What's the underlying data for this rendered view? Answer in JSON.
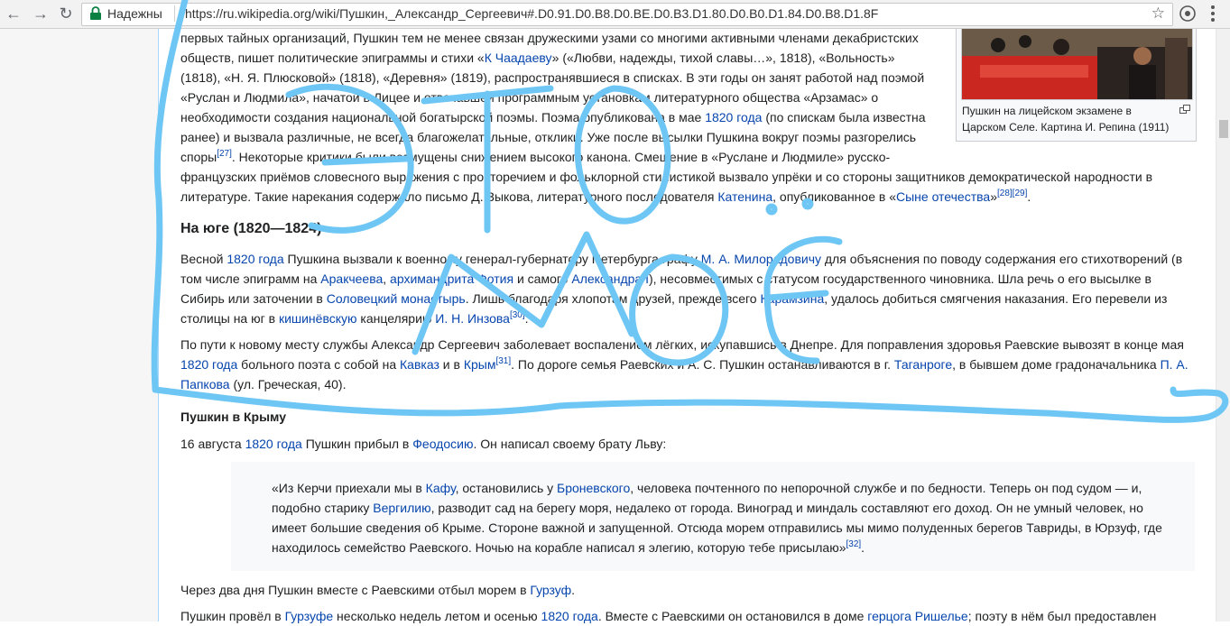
{
  "browser": {
    "secure_label": "Надежны",
    "url": "https://ru.wikipedia.org/wiki/Пушкин,_Александр_Сергеевич#.D0.91.D0.B8.D0.BE.D0.B3.D1.80.D0.B0.D1.84.D0.B8.D1.8F",
    "icons": [
      "back-arrow-icon",
      "forward-arrow-icon",
      "reload-icon",
      "lock-icon",
      "star-icon",
      "extension-icon",
      "menu-icon"
    ]
  },
  "article": {
    "p1": {
      "l1": "первых тайных организаций, Пушкин тем не менее связан дружескими узами со многими активными членами декабристских",
      "l2a": "обществ, пишет политические эпиграммы и стихи «",
      "l2link": "К Чаадаеву",
      "l2b": "» («Любви, надежды, тихой славы…», 1818), «Вольность»",
      "l3": "(1818), «Н. Я. Плюсковой» (1818), «Деревня» (1819), распространявшиеся в списках. В эти годы он занят работой над поэмой",
      "l4": "«Руслан и Людмила», начатой в Лицее и отвечавшей программным установкам литературного общества «Арзамас» о",
      "l5a": "необходимости создания национальной богатырской поэмы. Поэма опубликована в мае ",
      "l5link": "1820 года",
      "l5b": " (по спискам была известна",
      "l6": "ранее) и вызвала различные, не всегда благожелательные, отклики. Уже после высылки Пушкина вокруг поэмы разгорелись",
      "l7a": "споры",
      "l7ref": "[27]",
      "l7b": ". Некоторые критики были возмущены снижением высокого канона. Смешение в «Руслане и Людмиле» русско-",
      "l8": "французских приёмов словесного выражения с просторечием и фольклорной стилистикой вызвало упрёки и со стороны защитников демократической народности в",
      "l9a": "литературе. Такие нарекания содержало письмо Д. Зыкова, литературного последователя ",
      "l9link": "Катенина",
      "l9b": ", опубликованное в «",
      "l9link2": "Сыне отечества",
      "l9c": "»",
      "l9ref": "[28][29]",
      "l9d": "."
    },
    "section_south": "На юге (1820—1824)",
    "p2": {
      "l1a": "Весной ",
      "l1link": "1820 года",
      "l1b": " Пушкина вызвали к военному генерал-губернатору Петербурга графу ",
      "l1link2": "М. А. Милорадовичу",
      "l1c": " для объяснения по поводу содержания его стихотворений (в",
      "l2a": "том числе эпиграмм на ",
      "l2link": "Аракчеева",
      "l2b": ", ",
      "l2link2": "архимандрита Фотия",
      "l2c": " и самого ",
      "l2link3": "Александра I",
      "l2d": "), несовместимых с статусом государственного чиновника. Шла речь о его высылке в",
      "l3a": "Сибирь или заточении в ",
      "l3link": "Соловецкий монастырь",
      "l3b": ". Лишь благодаря хлопотам друзей, прежде всего ",
      "l3link2": "Карамзина",
      "l3c": ", удалось добиться смягчения наказания. Его перевели из",
      "l4a": "столицы на юг в ",
      "l4link": "кишинёвскую",
      "l4b": " канцелярию ",
      "l4link2": "И. Н. Инзова",
      "l4ref": "[30]",
      "l4c": "."
    },
    "p3": {
      "l1": "По пути к новому месту службы Александр Сергеевич заболевает воспалением лёгких, искупавшись в Днепре. Для поправления здоровья Раевские вывозят в конце мая",
      "l2link": "1820 года",
      "l2a": " больного поэта с собой на ",
      "l2link2": "Кавказ",
      "l2b": " и в ",
      "l2link3": "Крым",
      "l2ref": "[31]",
      "l2c": ". По дороге семья Раевских и А. С. Пушкин останавливаются в г. ",
      "l2link4": "Таганроге",
      "l2d": ", в бывшем доме градоначальника ",
      "l2link5": "П. А.",
      "l3link": "Папкова",
      "l3a": " (ул. Греческая, 40)."
    },
    "subsection_crimea": "Пушкин в Крыму",
    "p4": {
      "a": "16 августа ",
      "link": "1820 года",
      "b": " Пушкин прибыл в ",
      "link2": "Феодосию",
      "c": ". Он написал своему брату Льву:"
    },
    "quote": {
      "l1a": "«Из Керчи приехали мы в ",
      "l1link": "Кафу",
      "l1b": ", остановились у ",
      "l1link2": "Броневского",
      "l1c": ", человека почтенного по непорочной службе и по бедности. Теперь он под судом — и,",
      "l2a": "подобно старику ",
      "l2link": "Вергилию",
      "l2b": ", разводит сад на берегу моря, недалеко от города. Виноград и миндаль составляют его доход. Он не умный человек, но",
      "l3": "имеет большие сведения об Крыме. Стороне важной и запущенной. Отсюда морем отправились мы мимо полуденных берегов Тавриды, в Юрзуф, где",
      "l4": "находилось семейство Раевского. Ночью на корабле написал я элегию, которую тебе присылаю»",
      "l4ref": "[32]",
      "l4b": "."
    },
    "p5": {
      "a": "Через два дня Пушкин вместе с Раевскими отбыл морем в ",
      "link": "Гурзуф",
      "b": "."
    },
    "p6": {
      "a": "Пушкин провёл в ",
      "link": "Гурзуфе",
      "b": " несколько недель летом и осенью ",
      "link2": "1820 года",
      "c": ". Вместе с Раевскими он остановился в доме ",
      "link3": "герцога Ришелье",
      "d": "; поэту в нём был предоставлен"
    },
    "thumb_caption": "Пушкин на лицейском экзамене в Царском Селе. Картина И. Репина (1911)"
  },
  "colors": {
    "link": "#0645ad",
    "scribble": "#6ec6f5",
    "text": "#202122"
  }
}
